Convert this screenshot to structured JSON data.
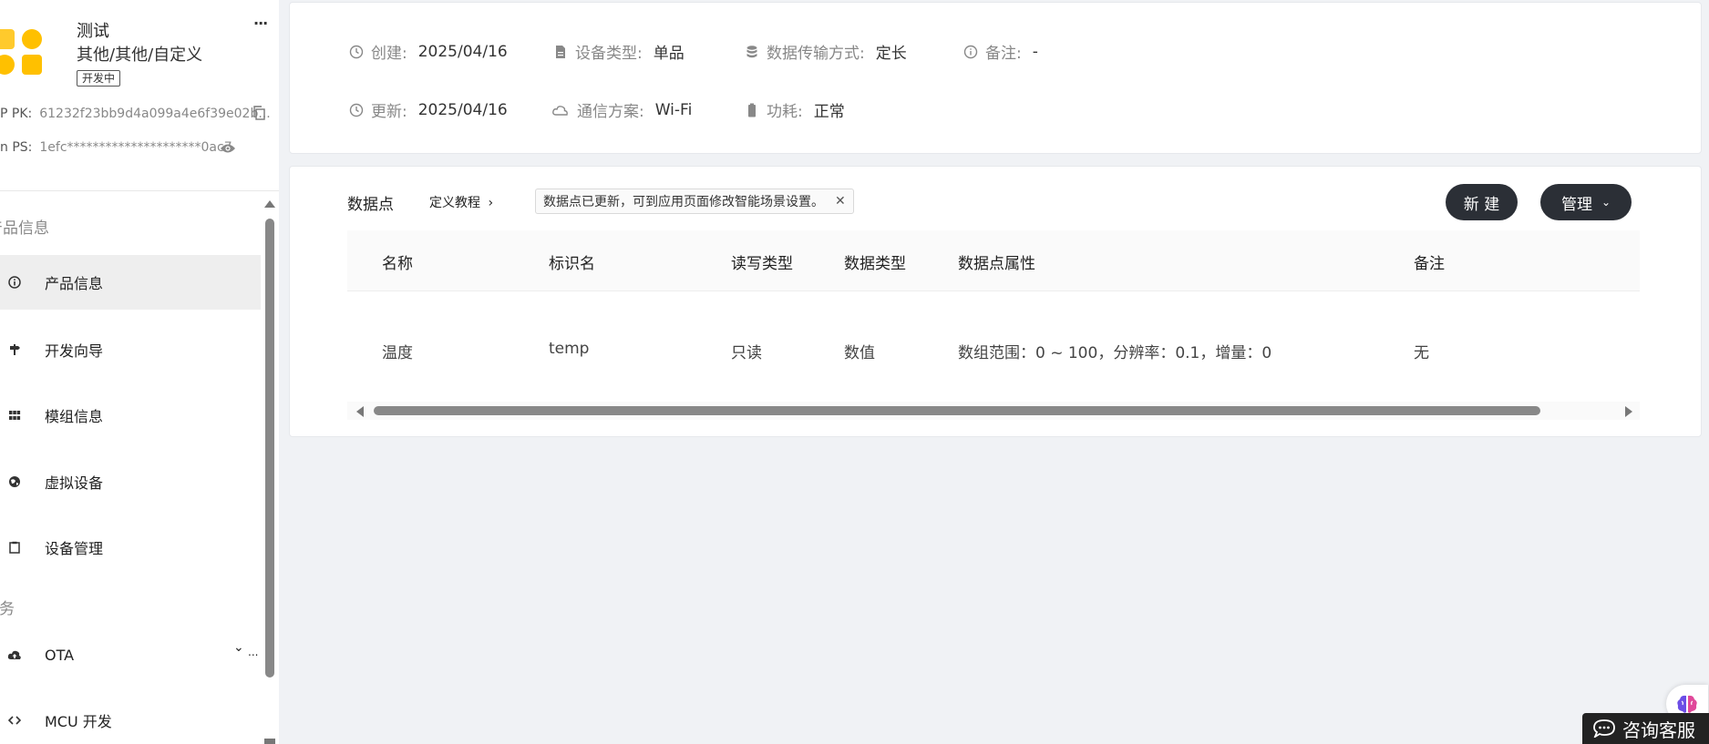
{
  "product": {
    "name": "测试",
    "category": "其他/其他/自定义",
    "status_badge": "开发中",
    "pk_label": "P PK:",
    "pk_value": "61232f23bb9d4a099a4e6f39e02b...",
    "ps_label": "n PS:",
    "ps_value": "1efc*********************0ac7"
  },
  "sidebar": {
    "section_product": "产品信息",
    "section_service": "服务",
    "items": [
      {
        "label": "产品信息",
        "icon": "info-icon",
        "active": true
      },
      {
        "label": "开发向导",
        "icon": "signpost-icon"
      },
      {
        "label": "模组信息",
        "icon": "grid-icon"
      },
      {
        "label": "虚拟设备",
        "icon": "globe-icon"
      },
      {
        "label": "设备管理",
        "icon": "clipboard-icon"
      },
      {
        "label": "OTA",
        "icon": "cloud-upload-icon"
      },
      {
        "label": "MCU 开发",
        "icon": "code-icon"
      }
    ]
  },
  "info": {
    "created_label": "创建:",
    "created_value": "2025/04/16",
    "updated_label": "更新:",
    "updated_value": "2025/04/16",
    "device_type_label": "设备类型:",
    "device_type_value": "单品",
    "transfer_label": "数据传输方式:",
    "transfer_value": "定长",
    "remark_label": "备注:",
    "remark_value": "-",
    "comm_label": "通信方案:",
    "comm_value": "Wi-Fi",
    "power_label": "功耗:",
    "power_value": "正常"
  },
  "datapoints": {
    "title": "数据点",
    "tutorial": "定义教程",
    "notice": "数据点已更新，可到应用页面修改智能场景设置。",
    "new_button": "新 建",
    "manage_button": "管理",
    "columns": [
      "名称",
      "标识名",
      "读写类型",
      "数据类型",
      "数据点属性",
      "备注"
    ],
    "rows": [
      [
        "温度",
        "temp",
        "只读",
        "数值",
        "数组范围：0 ~ 100，分辨率：0.1，增量：0",
        "无"
      ]
    ]
  },
  "support": {
    "label": "咨询客服"
  },
  "colors": {
    "accent_dark": "#2b2f36",
    "logo_yellow": "#ffc000",
    "background": "#f0f2f5"
  }
}
